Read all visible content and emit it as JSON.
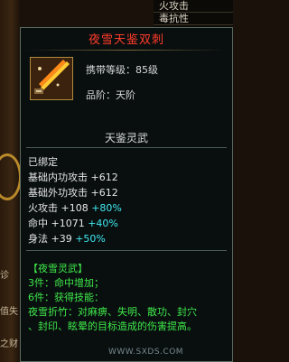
{
  "top_list": [
    "火攻击",
    "毒抗性"
  ],
  "left_fragments": [
    "诊",
    "值失",
    "之财"
  ],
  "item": {
    "name": "夜雪天鉴双刺",
    "carry_level": "携带等级：85级",
    "rank": "品阶：天阶",
    "grade_name": "天鉴灵武"
  },
  "stats": {
    "bound": "已绑定",
    "inner_attack": "基础内功攻击 +612",
    "outer_attack": "基础外功攻击 +612",
    "fire_label": "火攻击 +108",
    "fire_bonus": "+80%",
    "hit_label": "命中 +1071",
    "hit_bonus": "+40%",
    "agility_label": "身法 +39",
    "agility_bonus": "+50%"
  },
  "set": {
    "name": "【夜雪灵武】",
    "bonus_3": "3件：命中增加；",
    "bonus_6": "6件：获得技能：",
    "skill_line1": "夜雪折竹：对麻痹、失明、散功、封穴",
    "skill_line2": "、封印、眩晕的目标造成的伤害提高。"
  },
  "watermark": "WWW.SXDS.COM",
  "colors": {
    "title": "#ff3b2a",
    "stat_bonus": "#40e8f0",
    "set_text": "#3ee84a"
  },
  "icons": [
    "twin-dagger-item-icon"
  ]
}
